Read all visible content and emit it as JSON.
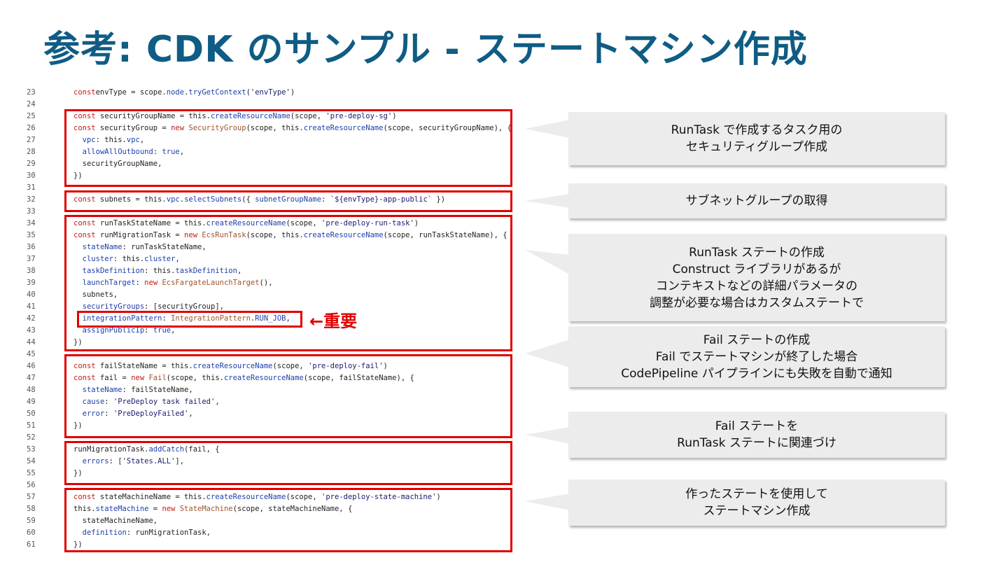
{
  "title": "参考: CDK のサンプル - ステートマシン作成",
  "code_lines": [
    {
      "ln": "23",
      "tokens": [
        [
          "kw",
          "const"
        ],
        [
          "",
          "envType = scope."
        ],
        [
          "prop",
          "node"
        ],
        [
          "",
          "."
        ],
        [
          "fn",
          "tryGetContext"
        ],
        [
          "",
          "("
        ],
        [
          "str",
          "'envType'"
        ],
        [
          "",
          ")"
        ]
      ]
    },
    {
      "ln": "24",
      "tokens": []
    },
    {
      "ln": "25",
      "tokens": [
        [
          "kw",
          "const"
        ],
        [
          "",
          " securityGroupName = this."
        ],
        [
          "fn",
          "createResourceName"
        ],
        [
          "",
          "(scope, "
        ],
        [
          "str",
          "'pre-deploy-sg'"
        ],
        [
          "",
          ")"
        ]
      ]
    },
    {
      "ln": "26",
      "tokens": [
        [
          "kw",
          "const"
        ],
        [
          "",
          " securityGroup = "
        ],
        [
          "kw",
          "new"
        ],
        [
          "",
          " "
        ],
        [
          "cls",
          "SecurityGroup"
        ],
        [
          "",
          "(scope, this."
        ],
        [
          "fn",
          "createResourceName"
        ],
        [
          "",
          "(scope, securityGroupName), {"
        ]
      ]
    },
    {
      "ln": "27",
      "tokens": [
        [
          "",
          "  "
        ],
        [
          "prop",
          "vpc"
        ],
        [
          "",
          ": this."
        ],
        [
          "prop",
          "vpc"
        ],
        [
          "",
          ","
        ]
      ]
    },
    {
      "ln": "28",
      "tokens": [
        [
          "",
          "  "
        ],
        [
          "prop",
          "allowAllOutbound"
        ],
        [
          "",
          ": "
        ],
        [
          "fn",
          "true"
        ],
        [
          "",
          ","
        ]
      ]
    },
    {
      "ln": "29",
      "tokens": [
        [
          "",
          "  securityGroupName,"
        ]
      ]
    },
    {
      "ln": "30",
      "tokens": [
        [
          "",
          "})"
        ]
      ]
    },
    {
      "ln": "31",
      "tokens": []
    },
    {
      "ln": "32",
      "tokens": [
        [
          "kw",
          "const"
        ],
        [
          "",
          " subnets = this."
        ],
        [
          "prop",
          "vpc"
        ],
        [
          "",
          "."
        ],
        [
          "fn",
          "selectSubnets"
        ],
        [
          "",
          "({ "
        ],
        [
          "prop",
          "subnetGroupName"
        ],
        [
          "",
          ": "
        ],
        [
          "str",
          "`${envType}-app-public`"
        ],
        [
          "",
          " })"
        ]
      ]
    },
    {
      "ln": "33",
      "tokens": []
    },
    {
      "ln": "34",
      "tokens": [
        [
          "kw",
          "const"
        ],
        [
          "",
          " runTaskStateName = this."
        ],
        [
          "fn",
          "createResourceName"
        ],
        [
          "",
          "(scope, "
        ],
        [
          "str",
          "'pre-deploy-run-task'"
        ],
        [
          "",
          ")"
        ]
      ]
    },
    {
      "ln": "35",
      "tokens": [
        [
          "kw",
          "const"
        ],
        [
          "",
          " runMigrationTask = "
        ],
        [
          "kw",
          "new"
        ],
        [
          "",
          " "
        ],
        [
          "cls",
          "EcsRunTask"
        ],
        [
          "",
          "(scope, this."
        ],
        [
          "fn",
          "createResourceName"
        ],
        [
          "",
          "(scope, runTaskStateName), {"
        ]
      ]
    },
    {
      "ln": "36",
      "tokens": [
        [
          "",
          "  "
        ],
        [
          "prop",
          "stateName"
        ],
        [
          "",
          ": runTaskStateName,"
        ]
      ]
    },
    {
      "ln": "37",
      "tokens": [
        [
          "",
          "  "
        ],
        [
          "prop",
          "cluster"
        ],
        [
          "",
          ": this."
        ],
        [
          "prop",
          "cluster"
        ],
        [
          "",
          ","
        ]
      ]
    },
    {
      "ln": "38",
      "tokens": [
        [
          "",
          "  "
        ],
        [
          "prop",
          "taskDefinition"
        ],
        [
          "",
          ": this."
        ],
        [
          "prop",
          "taskDefinition"
        ],
        [
          "",
          ","
        ]
      ]
    },
    {
      "ln": "39",
      "tokens": [
        [
          "",
          "  "
        ],
        [
          "prop",
          "launchTarget"
        ],
        [
          "",
          ": "
        ],
        [
          "kw",
          "new"
        ],
        [
          "",
          " "
        ],
        [
          "cls",
          "EcsFargateLaunchTarget"
        ],
        [
          "",
          "(),"
        ]
      ]
    },
    {
      "ln": "40",
      "tokens": [
        [
          "",
          "  subnets,"
        ]
      ]
    },
    {
      "ln": "41",
      "tokens": [
        [
          "",
          "  "
        ],
        [
          "prop",
          "securityGroups"
        ],
        [
          "",
          ": [securityGroup],"
        ]
      ]
    },
    {
      "ln": "42",
      "tokens": [
        [
          "",
          "  "
        ],
        [
          "prop",
          "integrationPattern"
        ],
        [
          "",
          ": "
        ],
        [
          "cls",
          "IntegrationPattern"
        ],
        [
          "",
          "."
        ],
        [
          "prop",
          "RUN_JOB"
        ],
        [
          "",
          ","
        ]
      ]
    },
    {
      "ln": "43",
      "tokens": [
        [
          "",
          "  "
        ],
        [
          "prop",
          "assignPublicIp"
        ],
        [
          "",
          ": "
        ],
        [
          "fn",
          "true"
        ],
        [
          "",
          ","
        ]
      ]
    },
    {
      "ln": "44",
      "tokens": [
        [
          "",
          "})"
        ]
      ]
    },
    {
      "ln": "45",
      "tokens": []
    },
    {
      "ln": "46",
      "tokens": [
        [
          "kw",
          "const"
        ],
        [
          "",
          " failStateName = this."
        ],
        [
          "fn",
          "createResourceName"
        ],
        [
          "",
          "(scope, "
        ],
        [
          "str",
          "'pre-deploy-fail'"
        ],
        [
          "",
          ")"
        ]
      ]
    },
    {
      "ln": "47",
      "tokens": [
        [
          "kw",
          "const"
        ],
        [
          "",
          " fail = "
        ],
        [
          "kw",
          "new"
        ],
        [
          "",
          " "
        ],
        [
          "cls",
          "Fail"
        ],
        [
          "",
          "(scope, this."
        ],
        [
          "fn",
          "createResourceName"
        ],
        [
          "",
          "(scope, failStateName), {"
        ]
      ]
    },
    {
      "ln": "48",
      "tokens": [
        [
          "",
          "  "
        ],
        [
          "prop",
          "stateName"
        ],
        [
          "",
          ": failStateName,"
        ]
      ]
    },
    {
      "ln": "49",
      "tokens": [
        [
          "",
          "  "
        ],
        [
          "prop",
          "cause"
        ],
        [
          "",
          ": "
        ],
        [
          "str",
          "'PreDeploy task failed'"
        ],
        [
          "",
          ","
        ]
      ]
    },
    {
      "ln": "50",
      "tokens": [
        [
          "",
          "  "
        ],
        [
          "prop",
          "error"
        ],
        [
          "",
          ": "
        ],
        [
          "str",
          "'PreDeployFailed'"
        ],
        [
          "",
          ","
        ]
      ]
    },
    {
      "ln": "51",
      "tokens": [
        [
          "",
          "})"
        ]
      ]
    },
    {
      "ln": "52",
      "tokens": []
    },
    {
      "ln": "53",
      "tokens": [
        [
          "",
          "runMigrationTask."
        ],
        [
          "fn",
          "addCatch"
        ],
        [
          "",
          "(fail, {"
        ]
      ]
    },
    {
      "ln": "54",
      "tokens": [
        [
          "",
          "  "
        ],
        [
          "prop",
          "errors"
        ],
        [
          "",
          ": ["
        ],
        [
          "str",
          "'States.ALL'"
        ],
        [
          "",
          "],"
        ]
      ]
    },
    {
      "ln": "55",
      "tokens": [
        [
          "",
          "})"
        ]
      ]
    },
    {
      "ln": "56",
      "tokens": []
    },
    {
      "ln": "57",
      "tokens": [
        [
          "kw",
          "const"
        ],
        [
          "",
          " stateMachineName = this."
        ],
        [
          "fn",
          "createResourceName"
        ],
        [
          "",
          "(scope, "
        ],
        [
          "str",
          "'pre-deploy-state-machine'"
        ],
        [
          "",
          ")"
        ]
      ]
    },
    {
      "ln": "58",
      "tokens": [
        [
          "",
          "this."
        ],
        [
          "prop",
          "stateMachine"
        ],
        [
          "",
          " = "
        ],
        [
          "kw",
          "new"
        ],
        [
          "",
          " "
        ],
        [
          "cls",
          "StateMachine"
        ],
        [
          "",
          "(scope, stateMachineName, {"
        ]
      ]
    },
    {
      "ln": "59",
      "tokens": [
        [
          "",
          "  stateMachineName,"
        ]
      ]
    },
    {
      "ln": "60",
      "tokens": [
        [
          "",
          "  "
        ],
        [
          "prop",
          "definition"
        ],
        [
          "",
          ": runMigrationTask,"
        ]
      ]
    },
    {
      "ln": "61",
      "tokens": [
        [
          "",
          "})"
        ]
      ]
    }
  ],
  "important_note": "←重要",
  "callouts": [
    {
      "text": "RunTask で作成するタスク用の\nセキュリティグループ作成"
    },
    {
      "text": "サブネットグループの取得"
    },
    {
      "text": "RunTask ステートの作成\nConstruct ライブラリがあるが\nコンテキストなどの詳細パラメータの\n調整が必要な場合はカスタムステートで"
    },
    {
      "text": "Fail ステートの作成\nFail でステートマシンが終了した場合\nCodePipeline パイプラインにも失敗を自動で通知"
    },
    {
      "text": "Fail ステートを\nRunTask ステートに関連づけ"
    },
    {
      "text": "作ったステートを使用して\nステートマシン作成"
    }
  ],
  "colors": {
    "title": "#0f5c84",
    "highlight": "#e00000",
    "callout_bg": "#ececec"
  }
}
